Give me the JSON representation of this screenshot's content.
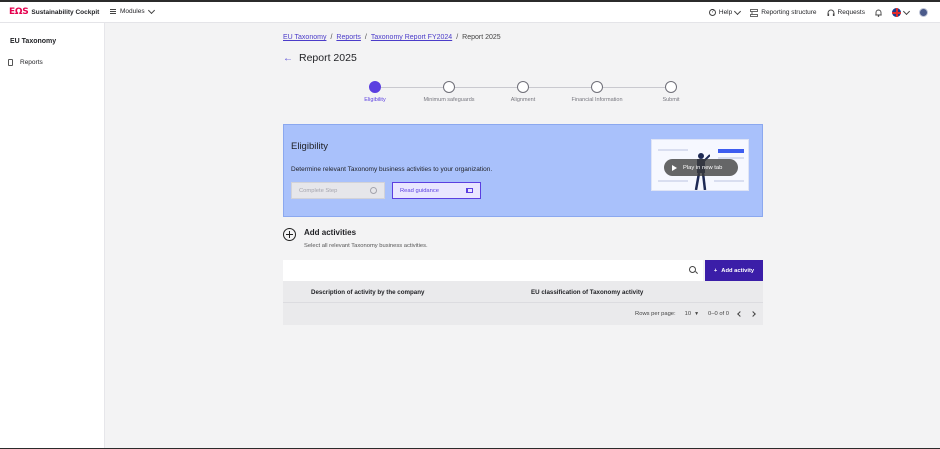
{
  "app": {
    "logo_mark": "ΕΩS",
    "name": "Sustainability Cockpit",
    "modules_label": "Modules"
  },
  "topbar": {
    "help_label": "Help",
    "reporting_structure_label": "Reporting structure",
    "requests_label": "Requests"
  },
  "sidebar": {
    "title": "EU Taxonomy",
    "items": [
      {
        "label": "Reports"
      }
    ]
  },
  "breadcrumb": {
    "items": [
      "EU Taxonomy",
      "Reports",
      "Taxonomy Report FY2024"
    ],
    "current": "Report 2025",
    "separator": "/"
  },
  "page": {
    "title": "Report 2025"
  },
  "stepper": {
    "steps": [
      {
        "label": "Eligibility",
        "active": true
      },
      {
        "label": "Minimum safeguards",
        "active": false
      },
      {
        "label": "Alignment",
        "active": false
      },
      {
        "label": "Financial Information",
        "active": false
      },
      {
        "label": "Submit",
        "active": false
      }
    ]
  },
  "eligibility_card": {
    "title": "Eligibility",
    "description": "Determine relevant Taxonomy business activities to your organization.",
    "complete_step_label": "Complete Step",
    "read_guidance_label": "Read guidance",
    "video_label": "Play in new tab"
  },
  "activities": {
    "title": "Add activities",
    "subtitle": "Select all relevant Taxonomy business activities.",
    "search_placeholder": "",
    "add_button_label": "Add activity",
    "add_button_prefix": "+",
    "columns": [
      "Description of activity by the company",
      "EU classification of Taxonomy activity"
    ],
    "rows": [],
    "pagination": {
      "rows_per_page_label": "Rows per page:",
      "rows_per_page_value": "10",
      "range": "0–0 of 0"
    }
  },
  "colors": {
    "accent": "#5b3fe0",
    "brand": "#e5004e",
    "card_bg": "#a9c1fb",
    "primary_button": "#3b1ea8"
  }
}
